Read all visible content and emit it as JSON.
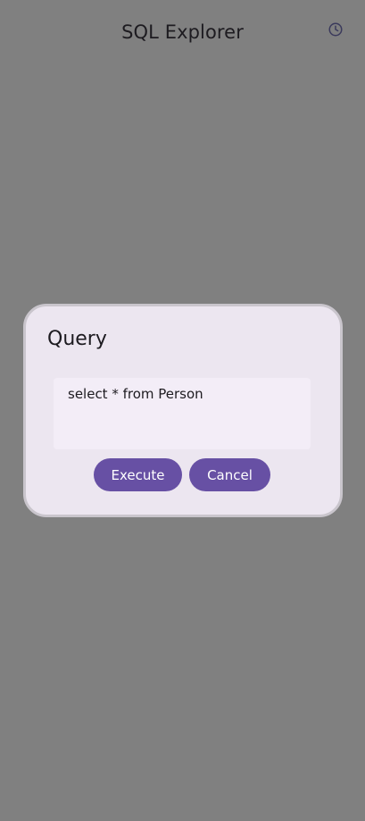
{
  "app_bar": {
    "title": "SQL Explorer",
    "history_icon": "history-icon"
  },
  "dialog": {
    "title": "Query",
    "query_value": "select * from Person",
    "execute_label": "Execute",
    "cancel_label": "Cancel"
  },
  "colors": {
    "scrim": "#808080",
    "dialog_bg": "#ece6f0",
    "field_bg": "#f3edf7",
    "accent": "#6750a4",
    "text": "#1d1b20"
  }
}
